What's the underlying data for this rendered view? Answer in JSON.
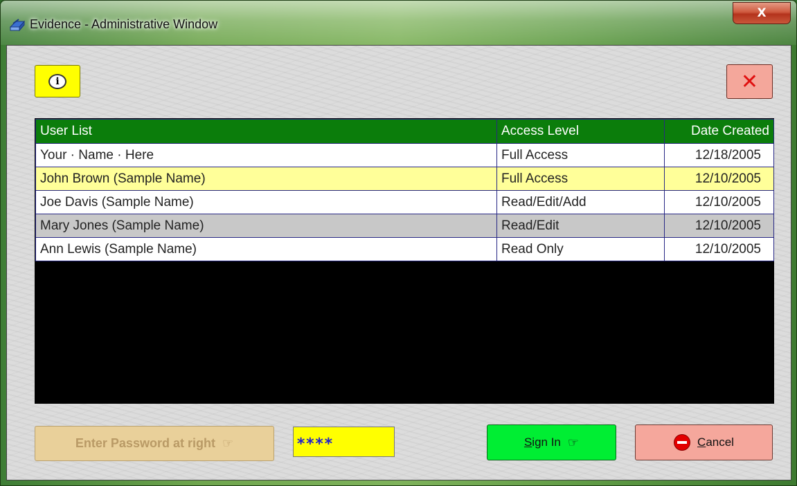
{
  "window": {
    "title": "Evidence - Administrative Window",
    "close_glyph": "X"
  },
  "toolbar": {
    "info_icon": "info-bubble-icon",
    "info_glyph": "i",
    "exit_icon": "red-x-icon",
    "exit_glyph": "✕"
  },
  "grid": {
    "columns": [
      "User List",
      "Access Level",
      "Date Created"
    ],
    "rows": [
      {
        "name": "Your · Name · Here",
        "access": "Full Access",
        "date": "12/18/2005"
      },
      {
        "name": "John Brown (Sample Name)",
        "access": "Full Access",
        "date": "12/10/2005"
      },
      {
        "name": "Joe Davis (Sample Name)",
        "access": "Read/Edit/Add",
        "date": "12/10/2005"
      },
      {
        "name": "Mary Jones (Sample Name)",
        "access": "Read/Edit",
        "date": "12/10/2005"
      },
      {
        "name": "Ann Lewis (Sample Name)",
        "access": "Read Only",
        "date": "12/10/2005"
      }
    ],
    "colors": {
      "header": "#0b7d0b",
      "selected": "#ffff99",
      "alt": "#c8c8c8"
    }
  },
  "footer": {
    "password_prompt": "Enter Password at right",
    "hand_glyph": "☞",
    "password_value": "****",
    "signin_label": "Sign In",
    "cancel_label": "Cancel",
    "cancel_icon": "stop-icon"
  }
}
